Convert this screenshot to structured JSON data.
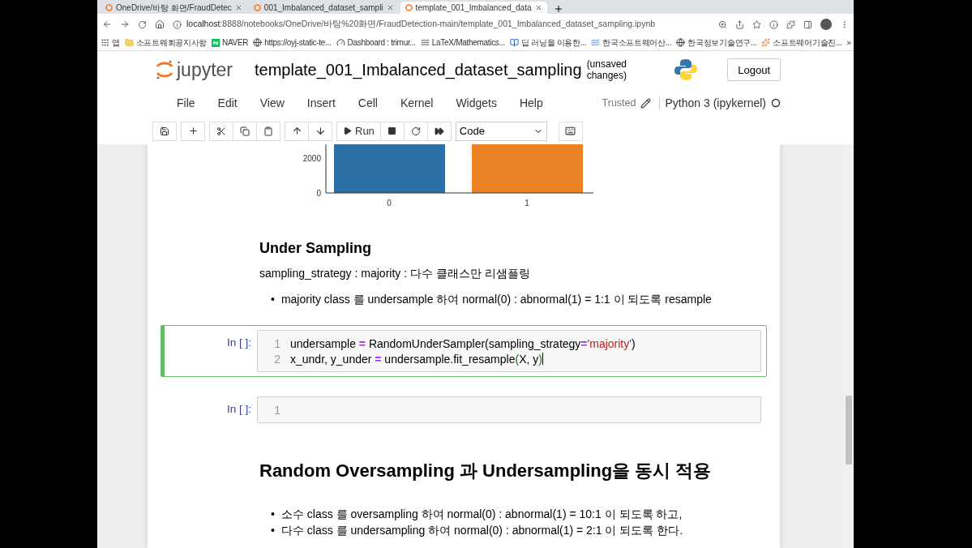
{
  "browser": {
    "tabs": [
      {
        "title": "OneDrive/바탕 화면/FraudDetec",
        "selected": false
      },
      {
        "title": "001_Imbalanced_dataset_sampli",
        "selected": false
      },
      {
        "title": "template_001_Imbalanced_data",
        "selected": true
      }
    ],
    "url_host": "localhost",
    "url_rest": ":8888/notebooks/OneDrive/바탕%20화면/FraudDetection-main/template_001_Imbalanced_dataset_sampling.ipynb",
    "bookmarks": [
      {
        "label": "앱",
        "kind": "apps"
      },
      {
        "label": "소프트웨회공지사항",
        "kind": "folder"
      },
      {
        "label": "NAVER",
        "kind": "naver"
      },
      {
        "label": "https://oyj-static-te...",
        "kind": "globe"
      },
      {
        "label": "Dashboard : trimur...",
        "kind": "dash"
      },
      {
        "label": "LaTeX/Mathematics...",
        "kind": "wiki"
      },
      {
        "label": "딥 러닝을 이용한...",
        "kind": "book"
      },
      {
        "label": "한국소프트웨어산...",
        "kind": "wave"
      },
      {
        "label": "한국정보기술연구...",
        "kind": "globe"
      },
      {
        "label": "소프트웨어기술진...",
        "kind": "star"
      }
    ],
    "more": "»"
  },
  "jupyter": {
    "logo": "jupyter",
    "title": "template_001_Imbalanced_dataset_sampling",
    "status": "(unsaved changes)",
    "logout": "Logout",
    "menu": [
      "File",
      "Edit",
      "View",
      "Insert",
      "Cell",
      "Kernel",
      "Widgets",
      "Help"
    ],
    "trusted": "Trusted",
    "kernel": "Python 3 (ipykernel)",
    "run": "Run",
    "cell_type": "Code"
  },
  "chart_fragment": {
    "yticks": [
      "2000",
      "0"
    ],
    "xticks": [
      "0",
      "1"
    ],
    "bars": [
      {
        "color": "#2c6fa6"
      },
      {
        "color": "#ea8226"
      }
    ]
  },
  "cells": [
    {
      "kind": "heading",
      "text": "Under Sampling"
    },
    {
      "kind": "paragraph",
      "text": "sampling_strategy :  majority : 다수 클래스만 리샘플링"
    },
    {
      "kind": "bullets",
      "marker": "•",
      "items": [
        "majority class 를 undersample 하여 normal(0) : abnormal(1) = 1:1 이 되도록 resample"
      ]
    },
    {
      "kind": "code",
      "selected": true,
      "prompt": "In [ ]:",
      "lines": [
        {
          "number": "1",
          "tokens": [
            {
              "kind": "name",
              "s": "undersample "
            },
            {
              "kind": "op",
              "s": "="
            },
            {
              "kind": "name",
              "s": " RandomUnderSampler(sampling_strategy"
            },
            {
              "kind": "op",
              "s": "="
            },
            {
              "kind": "str",
              "s": "'majority'"
            },
            {
              "kind": "name",
              "s": ")"
            }
          ]
        },
        {
          "number": "2",
          "tokens": [
            {
              "kind": "name",
              "s": "x_undr, y_under "
            },
            {
              "kind": "op",
              "s": "="
            },
            {
              "kind": "name",
              "s": " undersample.fit_resample"
            },
            {
              "kind": "br",
              "s": "("
            },
            {
              "kind": "name",
              "s": "X, y"
            },
            {
              "kind": "br",
              "s": ")"
            }
          ]
        }
      ]
    },
    {
      "kind": "code",
      "selected": false,
      "prompt": "In [ ]:",
      "lines": [
        {
          "number": "1"
        }
      ]
    },
    {
      "kind": "heading_big",
      "text": "Random Oversampling 과 Undersampling을 동시 적용"
    },
    {
      "kind": "bullets",
      "marker": "•",
      "items": [
        "소수 class 를 oversampling 하여 normal(0) : abnormal(1) = 10:1 이 되도록 하고,",
        "다수 class 를 undersampling 하여 normal(0) : abnormal(1) = 2:1 이 되도록 한다."
      ]
    }
  ]
}
